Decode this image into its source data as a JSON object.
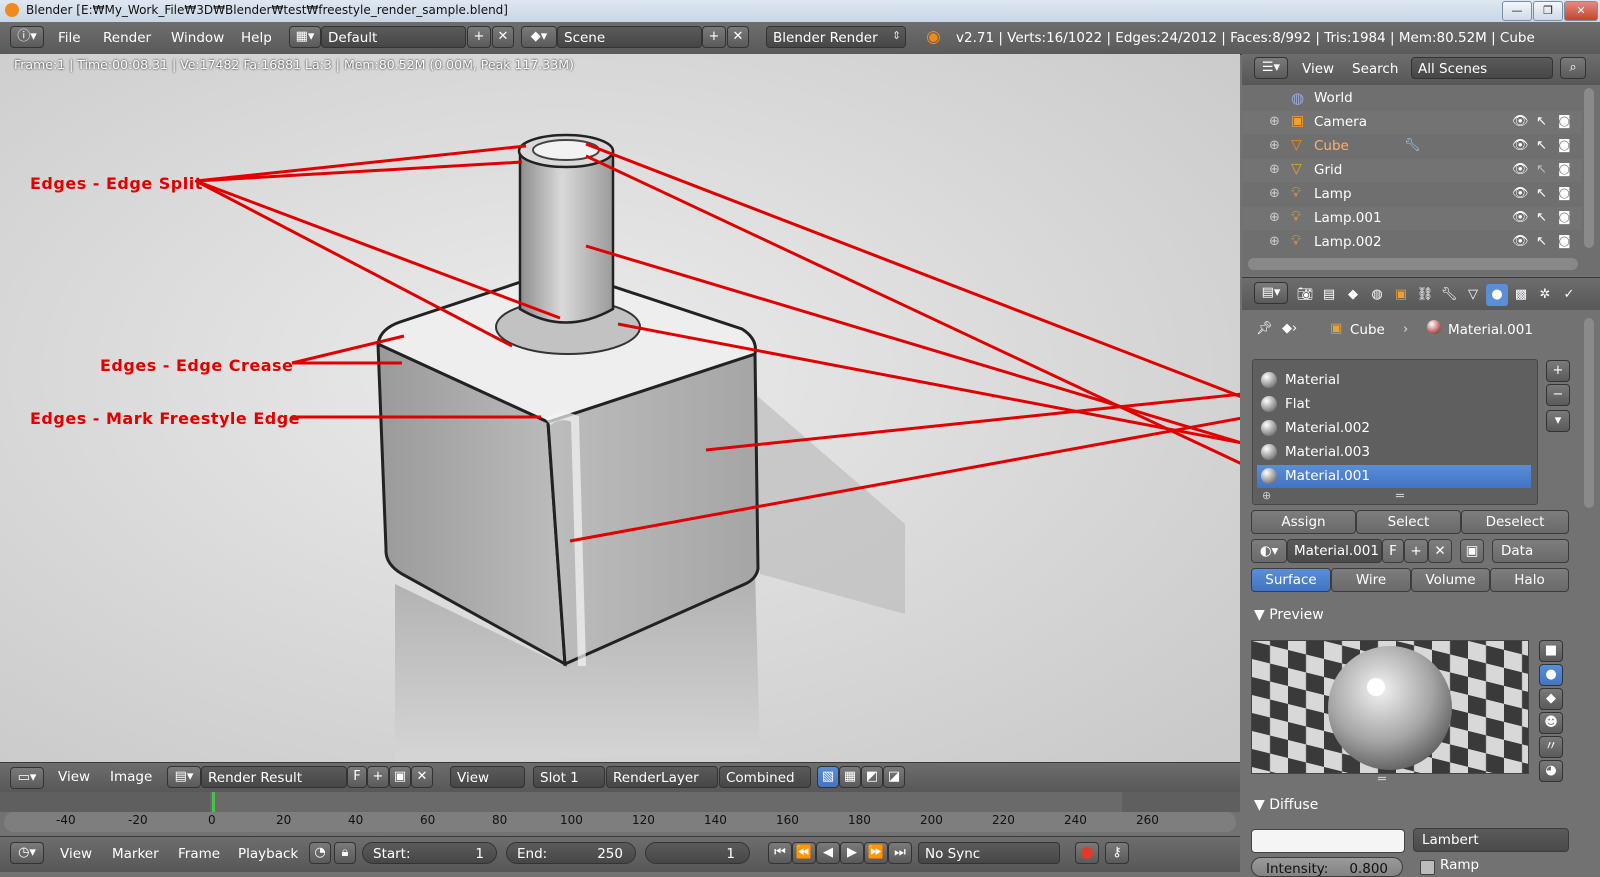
{
  "window": {
    "title": "Blender [E:₩My_Work_File₩3D₩Blender₩test₩freestyle_render_sample.blend]",
    "min_glyph": "—",
    "max_glyph": "❐",
    "close_glyph": "✕"
  },
  "info_header": {
    "menus": [
      "File",
      "Render",
      "Window",
      "Help"
    ],
    "screen_layout": "Default",
    "scene": "Scene",
    "render_engine": "Blender Render",
    "stats": "v2.71 | Verts:16/1022 | Edges:24/2012 | Faces:8/992 | Tris:1984 | Mem:80.52M | Cube"
  },
  "viewport": {
    "render_info": "Frame:1 | Time:00:08.31 | Ve:17482 Fa:16881 La:3 | Mem:80.52M (0.00M, Peak 117.33M)",
    "annotations": [
      "Edges - Edge Split",
      "Edges - Edge Crease",
      "Edges - Mark Freestyle Edge"
    ],
    "annotation_color": "#e00000"
  },
  "image_editor_header": {
    "menus": [
      "View",
      "Image"
    ],
    "image_name": "Render Result",
    "fake_user": "F",
    "view_mode": "View",
    "slot": "Slot 1",
    "render_layer": "RenderLayer",
    "pass": "Combined"
  },
  "timeline": {
    "ticks": [
      "-40",
      "-20",
      "0",
      "20",
      "40",
      "60",
      "80",
      "100",
      "120",
      "140",
      "160",
      "180",
      "200",
      "220",
      "240",
      "260"
    ],
    "menus": [
      "View",
      "Marker",
      "Frame",
      "Playback"
    ],
    "start_label": "Start:",
    "start_value": "1",
    "end_label": "End:",
    "end_value": "250",
    "current_frame": "1",
    "sync": "No Sync"
  },
  "outliner": {
    "menus": [
      "View",
      "Search"
    ],
    "display_mode": "All Scenes",
    "items": [
      {
        "label": "World",
        "icon": "world-icon"
      },
      {
        "label": "Camera",
        "icon": "camera-icon"
      },
      {
        "label": "Cube",
        "icon": "mesh-icon"
      },
      {
        "label": "Grid",
        "icon": "mesh-icon"
      },
      {
        "label": "Lamp",
        "icon": "lamp-icon"
      },
      {
        "label": "Lamp.001",
        "icon": "lamp-icon"
      },
      {
        "label": "Lamp.002",
        "icon": "lamp-icon"
      }
    ]
  },
  "properties": {
    "breadcrumb_object": "Cube",
    "breadcrumb_material": "Material.001",
    "material_slots": [
      "Material",
      "Flat",
      "Material.002",
      "Material.003",
      "Material.001"
    ],
    "selected_slot": 4,
    "assign": "Assign",
    "select": "Select",
    "deselect": "Deselect",
    "material_name": "Material.001",
    "fake_user": "F",
    "link": "Data",
    "tabs": [
      "Surface",
      "Wire",
      "Volume",
      "Halo"
    ],
    "preview_label": "Preview",
    "diffuse_label": "Diffuse",
    "diffuse_shader": "Lambert",
    "intensity_label": "Intensity:",
    "intensity_value": "0.800",
    "ramp_label": "Ramp"
  }
}
